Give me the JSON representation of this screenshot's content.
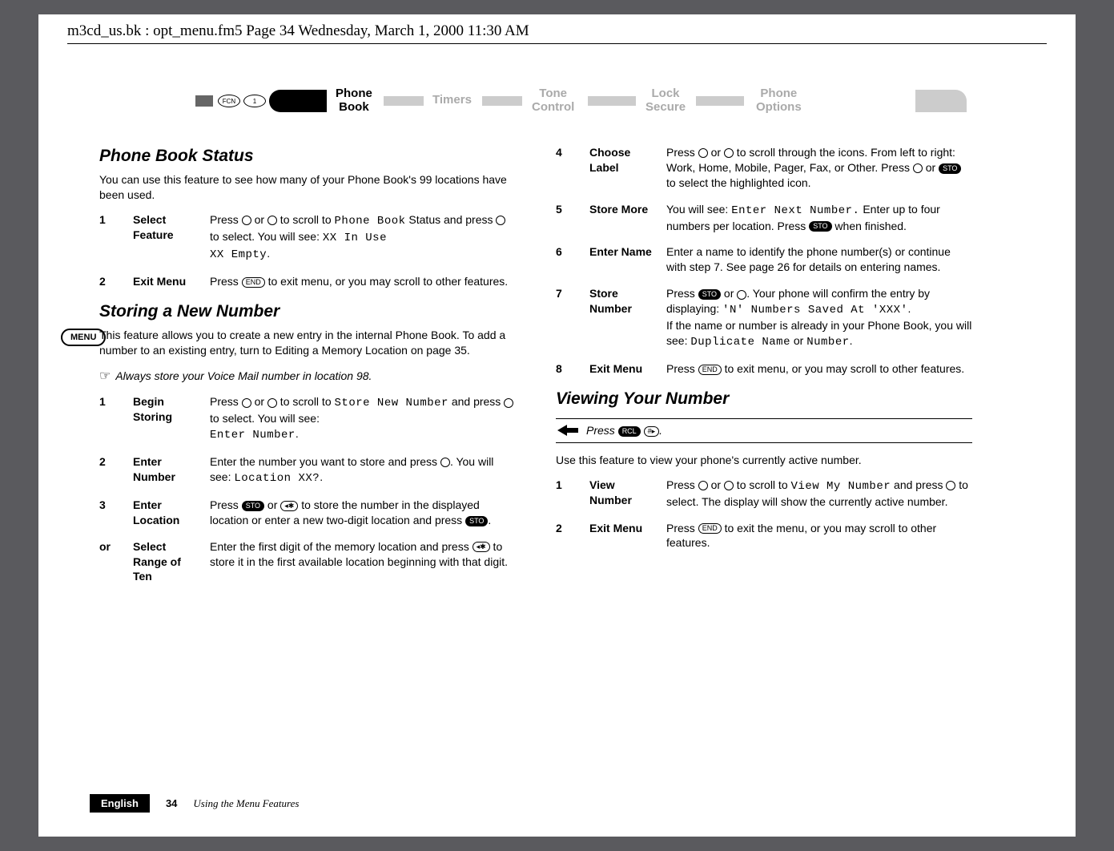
{
  "header_line": "m3cd_us.bk : opt_menu.fm5  Page 34  Wednesday, March 1, 2000  11:30 AM",
  "menu_badge": "MENU",
  "nav": {
    "fcn": "FCN",
    "one": "1",
    "phone_book": "Phone\nBook",
    "timers": "Timers",
    "tone_control": "Tone\nControl",
    "lock_secure": "Lock\nSecure",
    "phone_options": "Phone\nOptions"
  },
  "left": {
    "s1_title": "Phone Book Status",
    "s1_intro": "You can use this feature to see how many of your Phone Book's 99 locations have been used.",
    "s1_steps": [
      {
        "n": "1",
        "label": "Select Feature",
        "body_a": "Press ",
        "body_b": " or ",
        "body_c": " to scroll to ",
        "lcd1": "Phone Book",
        "body_d": " Status and press ",
        "body_e": " to select. You will see: ",
        "lcd2": "XX In Use",
        "lcd3": "XX Empty",
        "body_f": "."
      },
      {
        "n": "2",
        "label": "Exit Menu",
        "body_a": "Press ",
        "end": "END",
        "body_b": " to exit menu, or you may scroll to other features."
      }
    ],
    "s2_title": "Storing a New Number",
    "s2_intro": "This feature allows you to create a new entry in the internal Phone Book. To add a number to an existing entry, turn to Editing a Memory Location on page 35.",
    "s2_tip": "Always store your Voice Mail number in location 98.",
    "s2_steps": [
      {
        "n": "1",
        "label": "Begin Storing",
        "body_a": "Press ",
        "body_b": " or ",
        "body_c": " to scroll to ",
        "lcd1": "Store New Number",
        "body_d": " and press ",
        "body_e": " to select. You will see:",
        "lcd2": "Enter Number",
        "body_f": "."
      },
      {
        "n": "2",
        "label": "Enter Number",
        "body_a": "Enter the number you want to store and press ",
        "body_b": ". You will see: ",
        "lcd1": "Location XX?",
        "body_c": "."
      },
      {
        "n": "3",
        "label": "Enter Location",
        "body_a": "Press ",
        "sto": "STO",
        "body_b": " or ",
        "star": "◂✱",
        "body_c": " to store the number in the displayed location or enter a new two-digit location and press ",
        "sto2": "STO",
        "body_d": "."
      },
      {
        "n": "or",
        "label": "Select Range of Ten",
        "body_a": "Enter the first digit of the memory location and press ",
        "star": "◂✱",
        "body_b": " to store it in the first available location beginning with that digit."
      }
    ]
  },
  "right": {
    "steps": [
      {
        "n": "4",
        "label": "Choose Label",
        "body_a": "Press ",
        "body_b": " or ",
        "body_c": " to scroll through the icons. From left to right: Work, Home, Mobile, Pager, Fax, or Other. Press ",
        "body_d": " or ",
        "sto": "STO",
        "body_e": " to select the highlighted icon."
      },
      {
        "n": "5",
        "label": "Store More",
        "body_a": "You will see: ",
        "lcd1": "Enter Next Number.",
        "body_b": " Enter up to four numbers per location. Press ",
        "sto": "STO",
        "body_c": " when finished."
      },
      {
        "n": "6",
        "label": "Enter Name",
        "body": "Enter a name to identify the phone number(s) or continue with step 7. See page 26 for details on entering names."
      },
      {
        "n": "7",
        "label": "Store Number",
        "body_a": "Press ",
        "sto": "STO",
        "body_b": " or ",
        "body_c": ". Your phone will confirm the entry by displaying: ",
        "lcd1": "'N' Numbers Saved At 'XXX'",
        "body_d": ".",
        "body_e": "If the name or number is already in your Phone Book, you will see: ",
        "lcd2": "Duplicate Name",
        "body_f": " or ",
        "lcd3": "Number",
        "body_g": "."
      },
      {
        "n": "8",
        "label": "Exit Menu",
        "body_a": "Press ",
        "end": "END",
        "body_b": " to exit menu, or you may scroll to other features."
      }
    ],
    "s3_title": "Viewing Your Number",
    "s3_fast_a": "Press ",
    "s3_fast_rcl": "RCL",
    "s3_fast_hash": "#▸",
    "s3_fast_b": ".",
    "s3_intro": "Use this feature to view your phone's currently active number.",
    "s3_steps": [
      {
        "n": "1",
        "label": "View Number",
        "body_a": "Press ",
        "body_b": " or ",
        "body_c": " to scroll to ",
        "lcd1": "View My Number",
        "body_d": " and press ",
        "body_e": " to select. The display will show the currently active number."
      },
      {
        "n": "2",
        "label": "Exit Menu",
        "body_a": "Press ",
        "end": "END",
        "body_b": " to exit the menu, or you may scroll to other features."
      }
    ]
  },
  "footer": {
    "english": "English",
    "page": "34",
    "title": "Using the Menu Features"
  }
}
